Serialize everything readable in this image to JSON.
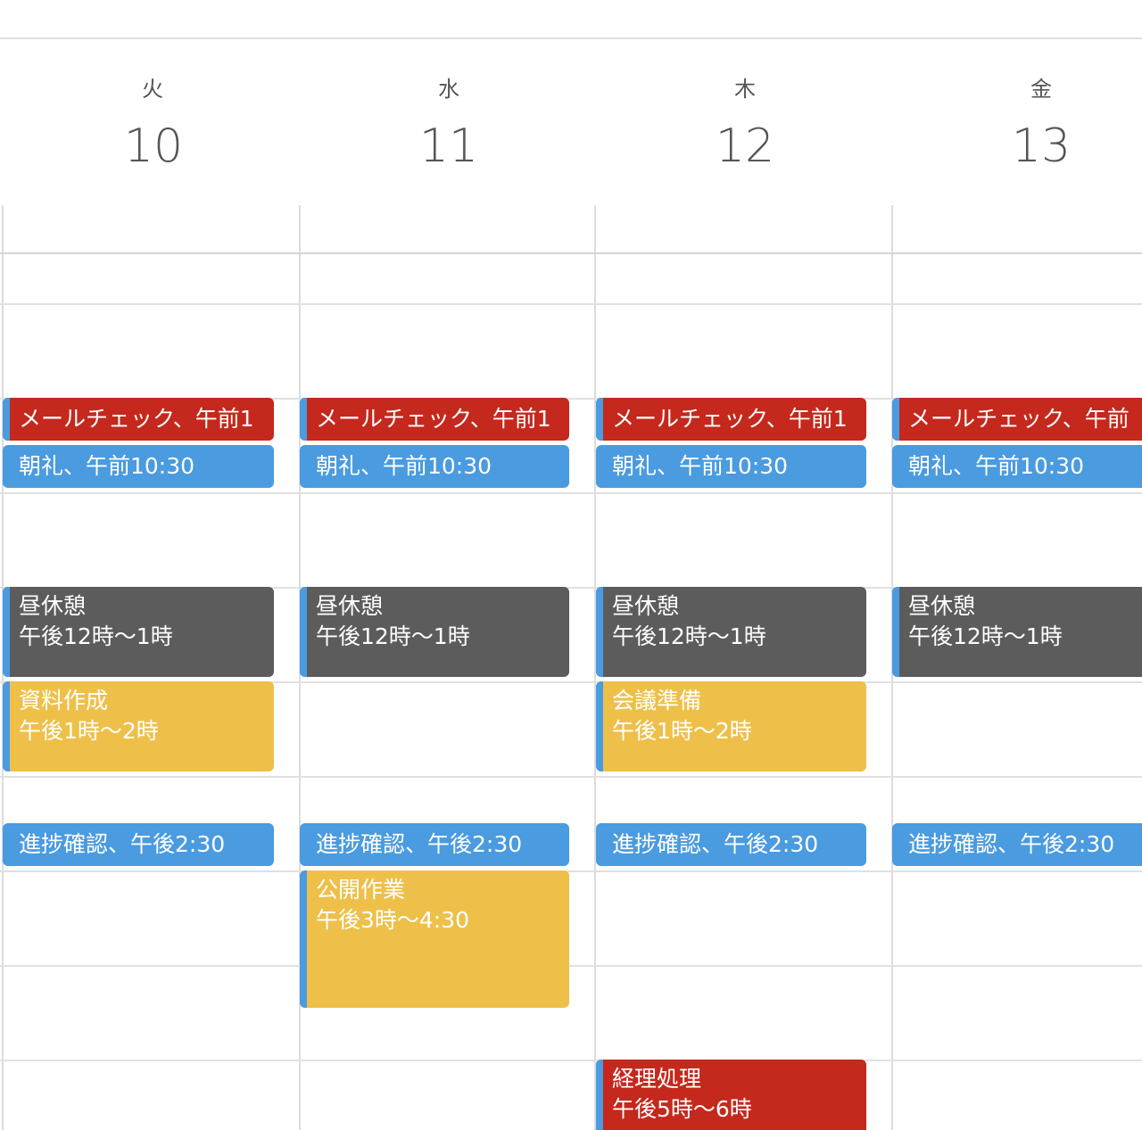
{
  "days": [
    {
      "dow": "火",
      "num": "10"
    },
    {
      "dow": "水",
      "num": "11"
    },
    {
      "dow": "木",
      "num": "12"
    },
    {
      "dow": "金",
      "num": "13"
    }
  ],
  "events": {
    "mail": "メールチェック、午前1",
    "mail_fri": "メールチェック、午前",
    "chorei": "朝礼、午前10:30",
    "lunch_title": "昼休憩",
    "lunch_time": "午後12時〜1時",
    "shiryo_title": "資料作成",
    "shiryo_time": "午後1時〜2時",
    "kaigi_title": "会議準備",
    "kaigi_time": "午後1時〜2時",
    "shinchoku": "進捗確認、午後2:30",
    "kokai_title": "公開作業",
    "kokai_time": "午後3時〜4:30",
    "keiri_title": "経理処理",
    "keiri_time": "午後5時〜6時"
  },
  "colors": {
    "red": "#c5281c",
    "blue": "#4a9be0",
    "gray": "#5c5c5c",
    "yellow": "#eec04a"
  }
}
